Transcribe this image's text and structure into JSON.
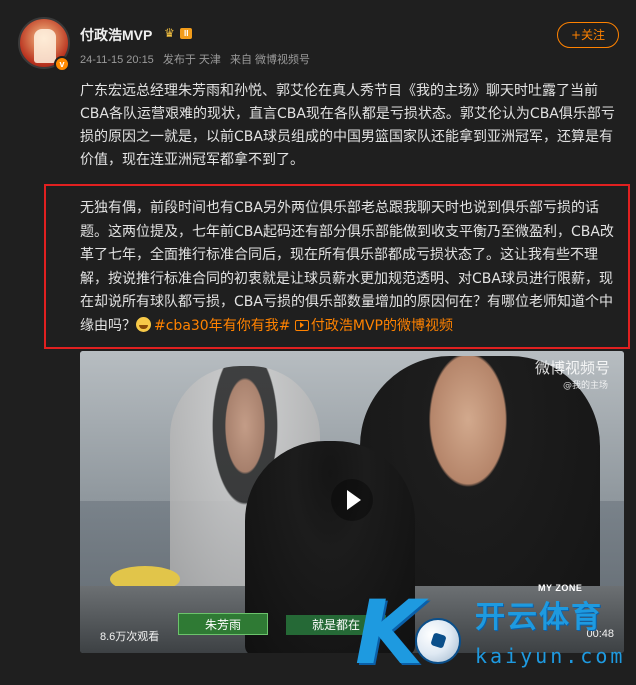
{
  "author": {
    "name": "付政浩MVP",
    "level_badge": "II",
    "verified_badge": "v"
  },
  "meta": {
    "timestamp": "24-11-15 20:15",
    "published_from": "发布于 天津",
    "source": "来自 微博视频号"
  },
  "follow_button": {
    "label": "+关注"
  },
  "post": {
    "paragraph1": "广东宏远总经理朱芳雨和孙悦、郭艾伦在真人秀节目《我的主场》聊天时吐露了当前CBA各队运营艰难的现状，直言CBA现在各队都是亏损状态。郭艾伦认为CBA俱乐部亏损的原因之一就是，以前CBA球员组成的中国男篮国家队还能拿到亚洲冠军，还算是有价值，现在连亚洲冠军都拿不到了。",
    "paragraph2": "无独有偶，前段时间也有CBA另外两位俱乐部老总跟我聊天时也说到俱乐部亏损的话题。这两位提及，七年前CBA起码还有部分俱乐部能做到收支平衡乃至微盈利，CBA改革了七年，全面推行标准合同后，现在所有俱乐部都成亏损状态了。这让我有些不理解，按说推行标准合同的初衷就是让球员薪水更加规范透明、对CBA球员进行限薪，现在却说所有球队都亏损，CBA亏损的俱乐部数量增加的原因何在？有哪位老师知道个中缘由吗？",
    "hashtag": "#cba30年有你有我#",
    "video_link": "付政浩MVP的微博视频"
  },
  "video": {
    "watermark": "微博视频号",
    "watermark_sub": "@我的主场",
    "lower_third_name": "朱芳雨",
    "lower_third_caption": "就是都在",
    "brand_text": "MY ZONE",
    "views": "8.6万次观看",
    "duration": "00:48"
  },
  "site_logo": {
    "letter": "K",
    "name": "开云体育",
    "url": "kaiyun.com"
  },
  "colors": {
    "background": "#1f1f1f",
    "accent": "#ff8200",
    "highlight_border": "#e02020",
    "logo_blue": "#1e9ae0"
  },
  "icons": [
    "avatar",
    "level-crown-icon",
    "verified-badge-icon",
    "grin-emoji-icon",
    "video-link-icon",
    "play-icon"
  ]
}
